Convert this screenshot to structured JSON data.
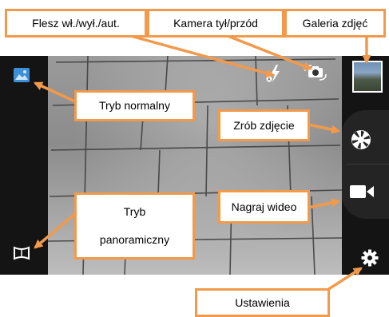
{
  "labels": {
    "flash": "Flesz wł./wył./aut.",
    "camera_switch": "Kamera tył/przód",
    "gallery": "Galeria zdjęć",
    "normal_mode": "Tryb normalny",
    "take_photo": "Zrób zdjęcie",
    "panorama_line1": "Tryb",
    "panorama_line2": "panoramiczny",
    "record_video": "Nagraj wideo",
    "settings": "Ustawienia"
  },
  "icons": {
    "normal_mode": "image-mode-icon",
    "panorama_mode": "panorama-mode-icon",
    "flash": "flash-auto-icon",
    "camera_switch": "camera-switch-icon",
    "gallery": "gallery-thumbnail",
    "shutter": "aperture-icon",
    "video": "video-camera-icon",
    "settings": "gear-icon"
  },
  "colors": {
    "callout_border": "#f29a4c",
    "arrow": "#f29a4c",
    "accent_blue": "#3d8fd8",
    "ui_background": "#141414"
  }
}
